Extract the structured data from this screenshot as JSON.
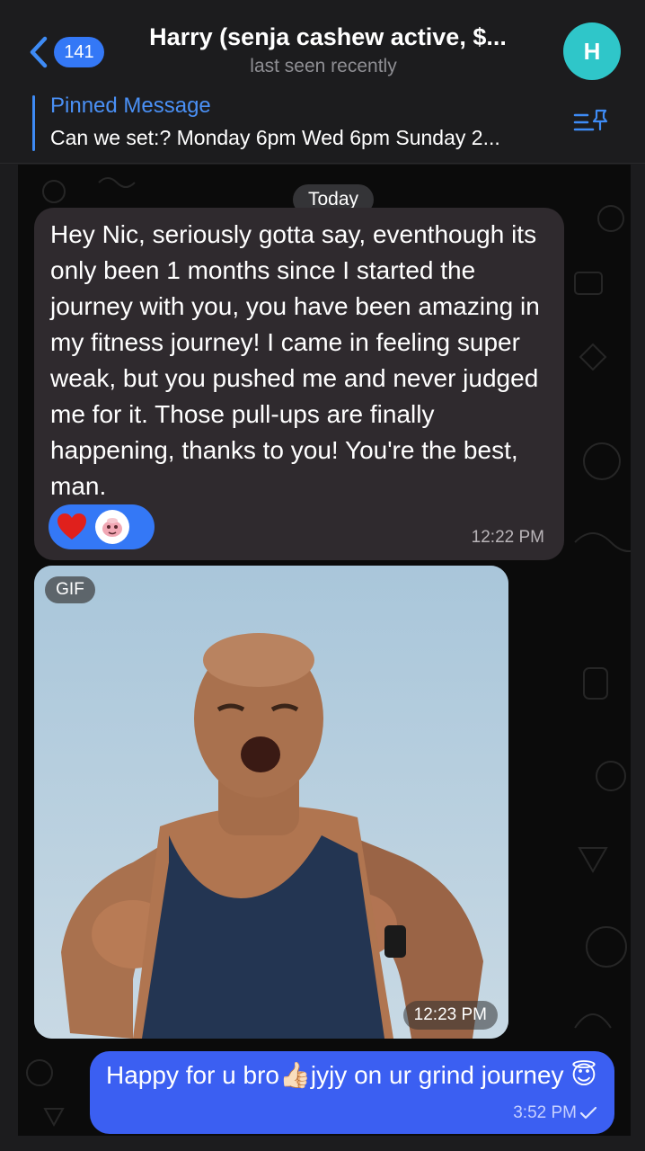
{
  "header": {
    "back_badge": "141",
    "title": "Harry (senja cashew active, $...",
    "subtitle": "last seen recently",
    "avatar_initial": "H"
  },
  "pinned": {
    "label": "Pinned Message",
    "text": "Can we set:? Monday 6pm Wed 6pm Sunday 2..."
  },
  "chat": {
    "date_label": "Today",
    "messages": [
      {
        "direction": "incoming",
        "text": "Hey Nic, seriously gotta say, eventhough its only been 1 months since I started the journey with you, you have been amazing in my fitness journey! I came in feeling super weak, but you pushed me and never judged me for it.  Those pull-ups are finally happening, thanks to you! You're the best, man.",
        "time": "12:22 PM",
        "reactions": [
          "heart-reaction-icon",
          "sticker-reaction-icon"
        ]
      },
      {
        "direction": "incoming",
        "type": "gif",
        "tag": "GIF",
        "time": "12:23 PM"
      },
      {
        "direction": "outgoing",
        "text": "Happy for u bro👍🏻jyjy on ur grind journey 😇",
        "time": "3:52 PM"
      }
    ]
  },
  "colors": {
    "accent": "#3478f6",
    "outgoing_bubble": "#3b5ff2",
    "incoming_bubble": "#2f2a2e",
    "avatar": "#2fc6c9",
    "background": "#0b0b0b"
  }
}
